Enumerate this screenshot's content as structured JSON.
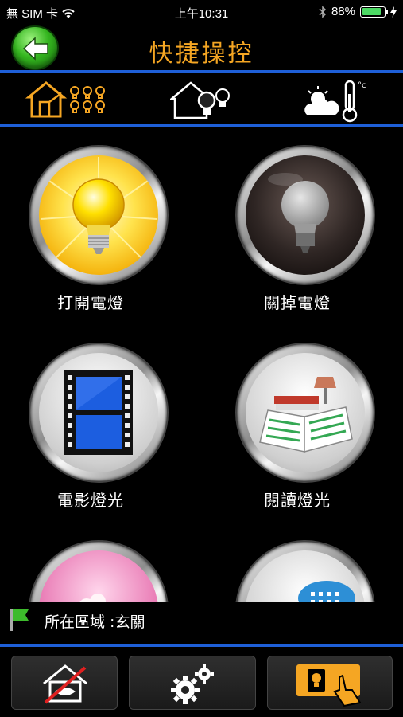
{
  "status_bar": {
    "carrier": "無 SIM 卡",
    "time": "上午10:31",
    "battery": "88%",
    "battery_level": 0.88,
    "icons": [
      "wifi-icon",
      "bluetooth-icon",
      "battery-icon",
      "charging-icon"
    ]
  },
  "header": {
    "title": "快捷操控",
    "back_icon": "back-arrow-icon"
  },
  "tabs": [
    {
      "name": "scene-lights-tab",
      "icon": "house-bulbs-icon"
    },
    {
      "name": "home-light-tab",
      "icon": "house-bulb-icon"
    },
    {
      "name": "climate-tab",
      "icon": "weather-thermometer-icon",
      "unit": "°c"
    }
  ],
  "scenes": [
    {
      "label": "打開電燈",
      "icon": "bulb-on-icon"
    },
    {
      "label": "關掉電燈",
      "icon": "bulb-off-icon"
    },
    {
      "label": "電影燈光",
      "icon": "film-icon"
    },
    {
      "label": "閱讀燈光",
      "icon": "book-lamp-icon"
    },
    {
      "label": "",
      "icon": "flower-icon"
    },
    {
      "label": "",
      "icon": "chat-icon"
    }
  ],
  "location": {
    "text": "所在區域 :玄關",
    "icon": "green-flag-icon"
  },
  "toolbar": {
    "buttons": [
      {
        "icon": "home-hidden-icon"
      },
      {
        "icon": "gears-icon"
      },
      {
        "icon": "touch-panel-icon"
      }
    ]
  },
  "colors": {
    "accent": "#f5a623",
    "divider": "#1e5fd8",
    "back_button": "#34b51f"
  }
}
